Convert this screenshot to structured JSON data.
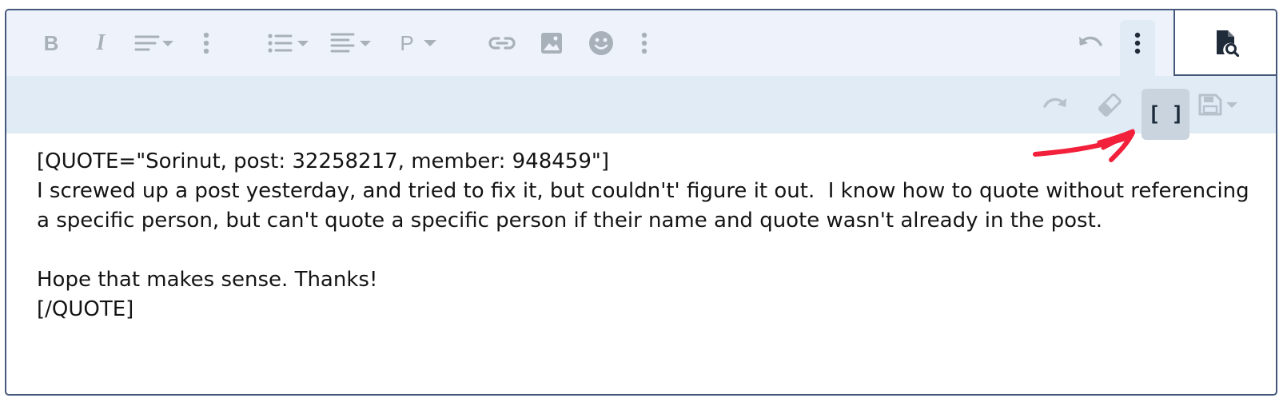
{
  "toolbar": {
    "row1": [
      {
        "name": "bold-button",
        "icon": "bold-icon",
        "label": "B"
      },
      {
        "name": "italic-button",
        "icon": "italic-icon",
        "label": "I"
      },
      {
        "name": "text-style-dropdown",
        "icon": "text-lines-icon"
      },
      {
        "name": "more-text-options-button",
        "icon": "more-vertical-icon"
      },
      {
        "name": "list-dropdown",
        "icon": "list-icon"
      },
      {
        "name": "align-dropdown",
        "icon": "align-left-icon"
      },
      {
        "name": "paragraph-format-dropdown",
        "icon": "paragraph-icon",
        "label": "P"
      },
      {
        "name": "insert-link-button",
        "icon": "link-icon"
      },
      {
        "name": "insert-image-button",
        "icon": "image-icon"
      },
      {
        "name": "insert-emoji-button",
        "icon": "smiley-icon"
      },
      {
        "name": "more-insert-options-button",
        "icon": "more-vertical-icon"
      },
      {
        "name": "undo-button",
        "icon": "undo-icon"
      },
      {
        "name": "more-actions-button",
        "icon": "more-vertical-icon"
      },
      {
        "name": "preview-button",
        "icon": "document-search-icon"
      }
    ],
    "row2": [
      {
        "name": "redo-button",
        "icon": "redo-icon"
      },
      {
        "name": "remove-formatting-button",
        "icon": "eraser-icon"
      },
      {
        "name": "toggle-bbcode-button",
        "icon": "brackets-icon",
        "label": "[ ]",
        "active": true
      },
      {
        "name": "drafts-dropdown",
        "icon": "save-icon"
      }
    ]
  },
  "editor": {
    "content": "[QUOTE=\"Sorinut, post: 32258217, member: 948459\"]\nI screwed up a post yesterday, and tried to fix it, but couldn't' figure it out.  I know how to quote without referencing a specific person, but can't quote a specific person if their name and quote wasn't already in the post.\n\nHope that makes sense. Thanks!\n[/QUOTE]"
  },
  "colors": {
    "toolbar_bg": "#eef3fb",
    "toolbar_row2_bg": "#e0ebf6",
    "icon_muted": "#a8b0b9",
    "icon_dark": "#1f2b39",
    "border": "#45597a",
    "active_button_bg": "#c9d4de",
    "annotation_red": "#f2203a"
  }
}
